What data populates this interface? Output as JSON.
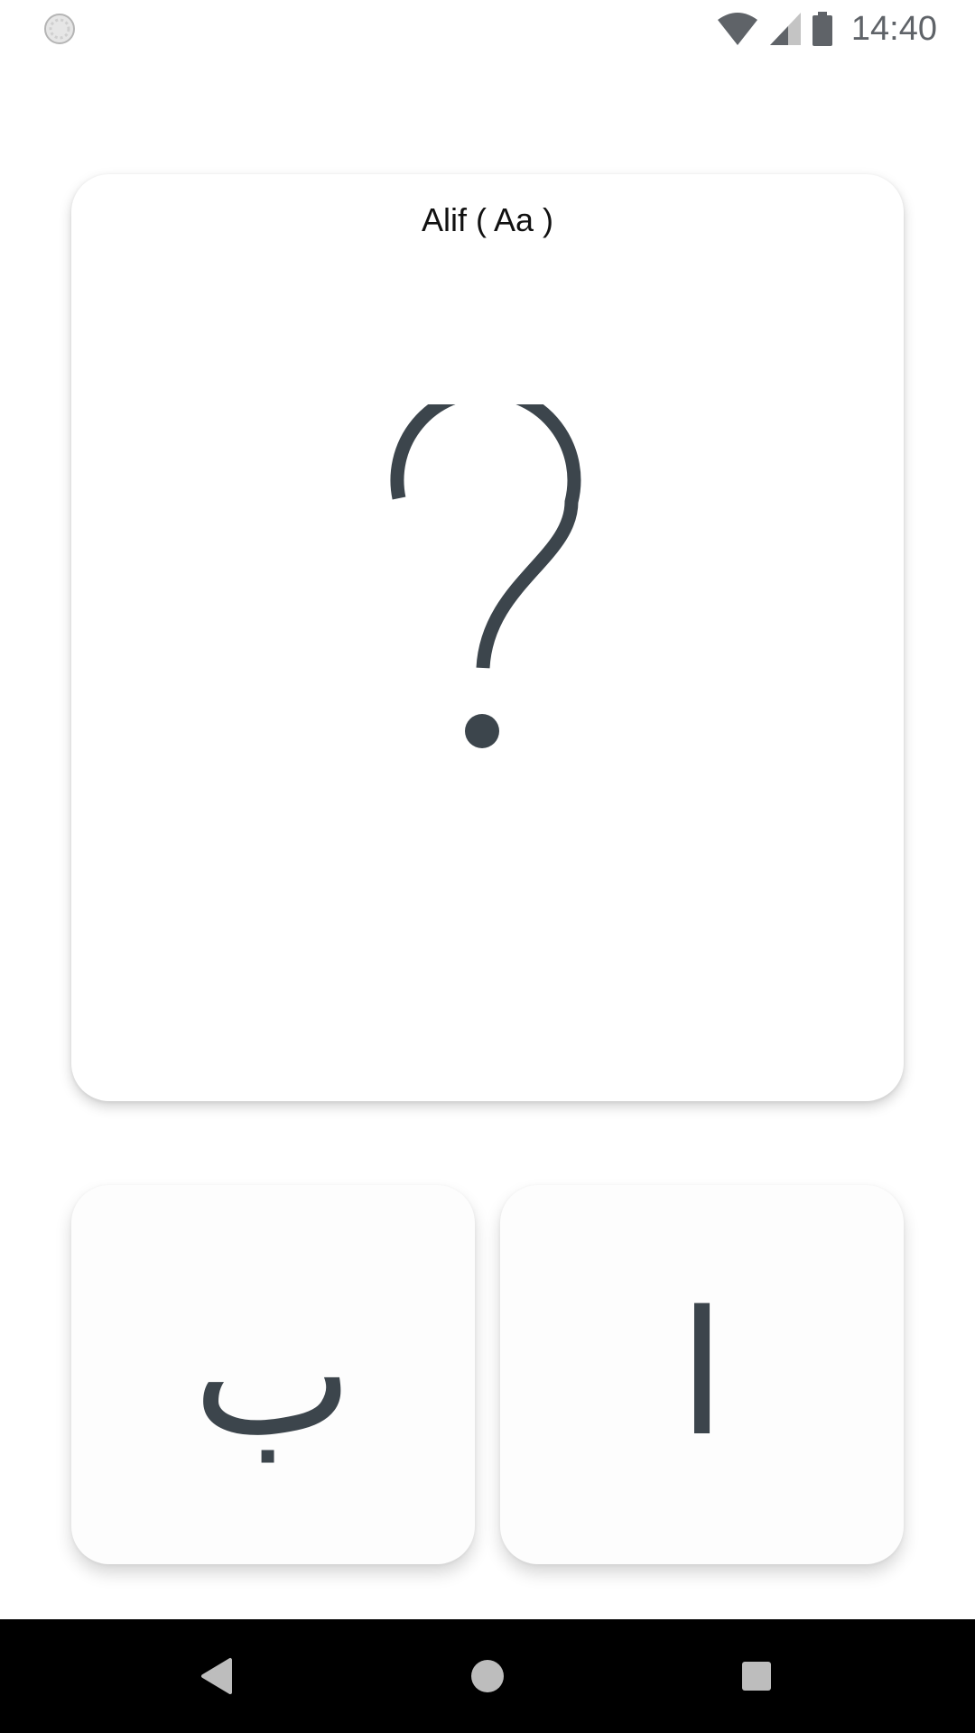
{
  "status_bar": {
    "time": "14:40",
    "icons": [
      "sync-indicator-icon",
      "wifi-icon",
      "cell-signal-icon",
      "battery-icon"
    ]
  },
  "question_card": {
    "title": "Alif ( Aa )",
    "placeholder_icon": "question-mark-icon"
  },
  "answers": [
    {
      "letter": "ب"
    },
    {
      "letter": "ا"
    }
  ],
  "nav_bar": {
    "icons": [
      "back-icon",
      "home-icon",
      "recents-icon"
    ]
  },
  "colors": {
    "glyph": "#3c454c",
    "status_icons": "#5f6368",
    "nav_bar_bg": "#000000",
    "card_bg": "#ffffff"
  }
}
